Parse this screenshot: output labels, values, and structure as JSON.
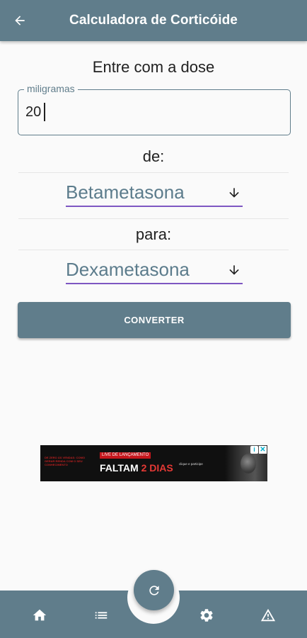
{
  "appbar": {
    "title": "Calculadora de Corticóide"
  },
  "form": {
    "prompt": "Entre com a dose",
    "dose_field": {
      "label": "miligramas",
      "value": "20"
    },
    "from_label": "de:",
    "from_select": {
      "value": "Betametasona"
    },
    "to_label": "para:",
    "to_select": {
      "value": "Dexametasona"
    },
    "convert_label": "CONVERTER"
  },
  "ad": {
    "badge": "LIVE DE LANÇAMENTO",
    "headline_prefix": "FALTAM",
    "headline_highlight": "2 DIAS",
    "left_text": "DE ZERO ÀS VENDAS: COMO GERAR RENDA COM O SEU CONHECIMENTO",
    "small_text": "clique e participe"
  },
  "bottom_nav": {
    "icons": [
      "home-icon",
      "list-icon",
      "refresh-icon",
      "settings-icon",
      "warning-icon"
    ]
  },
  "colors": {
    "primary": "#607d8b",
    "underline": "#7e57c2",
    "select_text": "#5c7c8c",
    "background": "#fafafa"
  }
}
